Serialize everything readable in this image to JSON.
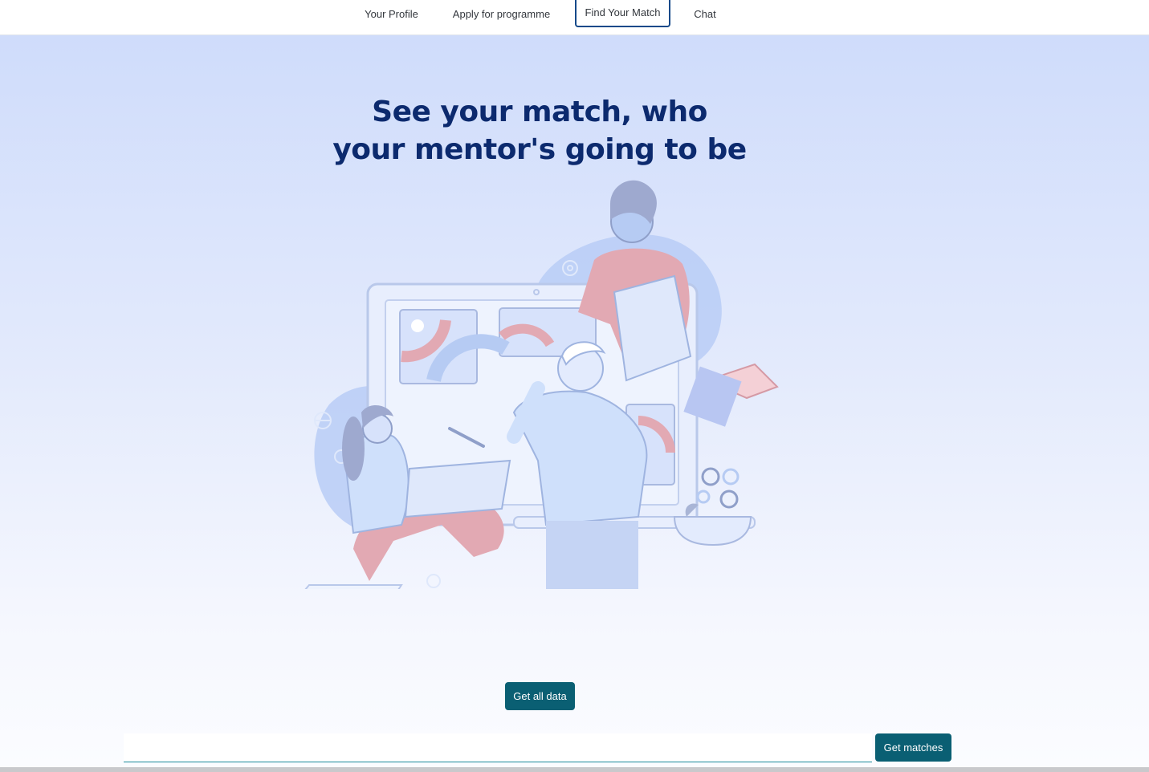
{
  "nav": {
    "items": [
      {
        "label": "Your Profile",
        "active": false
      },
      {
        "label": "Apply for programme",
        "active": false
      },
      {
        "label": "Find Your Match",
        "active": true
      },
      {
        "label": "Chat",
        "active": false
      }
    ]
  },
  "hero": {
    "title_line1": "See your match, who",
    "title_line2": "your mentor's going to be"
  },
  "actions": {
    "get_all_label": "Get all data",
    "get_matches_label": "Get matches"
  },
  "search": {
    "value": "",
    "placeholder": ""
  },
  "colors": {
    "accent": "#0a5f73",
    "headline": "#0c2a6e",
    "hero_top": "#cfdcfb",
    "hero_bottom": "#fbfcff",
    "illustration_blue": "#b8cdf6",
    "illustration_red": "#e2a9b3"
  }
}
